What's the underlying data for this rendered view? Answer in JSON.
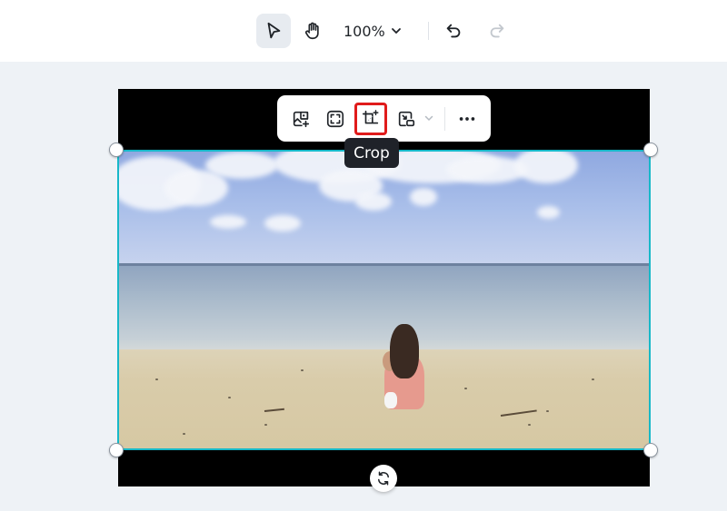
{
  "topbar": {
    "tools": [
      {
        "name": "select",
        "icon": "cursor-arrow-icon",
        "active": true
      },
      {
        "name": "hand",
        "icon": "hand-pan-icon",
        "active": false
      }
    ],
    "zoom_level": "100%",
    "undo": {
      "icon": "undo-icon",
      "enabled": true
    },
    "redo": {
      "icon": "redo-icon",
      "enabled": false
    }
  },
  "context_toolbar": {
    "buttons": [
      {
        "name": "replace-image",
        "icon": "image-plus-icon"
      },
      {
        "name": "fit-frame",
        "icon": "fullscreen-corners-icon"
      },
      {
        "name": "crop",
        "icon": "crop-icon",
        "highlighted": true
      },
      {
        "name": "picture-in-picture",
        "icon": "pip-icon",
        "has_dropdown": true
      },
      {
        "name": "more",
        "icon": "more-horizontal-icon"
      }
    ],
    "tooltip": "Crop"
  },
  "canvas": {
    "frame_color": "#000000",
    "selection_color": "#17b8c8",
    "image_description": "Woman sitting on a sandy beach facing the ocean under a blue sky with clouds",
    "rotate_icon": "rotate-icon"
  },
  "colors": {
    "highlight": "#e01b1b",
    "tooltip_bg": "#1f2229",
    "canvas_bg": "#eef2f6"
  }
}
